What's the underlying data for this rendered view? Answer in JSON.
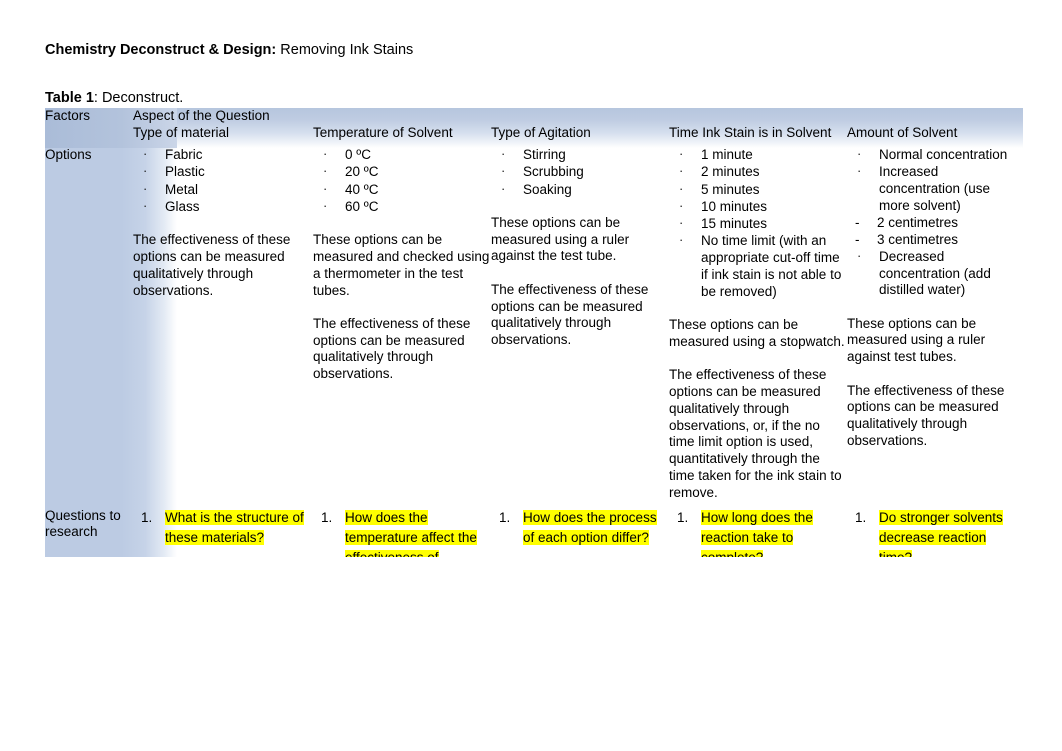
{
  "document": {
    "title_bold": "Chemistry Deconstruct & Design:",
    "title_rest": " Removing Ink Stains",
    "caption_bold": "Table 1",
    "caption_rest": ": Deconstruct."
  },
  "colors": {
    "header_band": "#b6c6de",
    "first_column_band": "#bccbe3",
    "highlight": "#ffff00"
  },
  "table": {
    "header": {
      "factors_label": "Factors",
      "aspect_label": "Aspect of the Question",
      "columns": [
        "Type of material",
        "Temperature of Solvent",
        "Type of Agitation",
        "Time Ink Stain is in Solvent",
        "Amount of Solvent"
      ]
    },
    "rows": [
      {
        "label": "Options",
        "cells": [
          {
            "bullets": [
              "Fabric",
              "Plastic",
              "Metal",
              "Glass"
            ],
            "paragraphs": [
              "The effectiveness of these options can be measured qualitatively through observations."
            ]
          },
          {
            "bullets": [
              "0 ºC",
              "20 ºC",
              "40 ºC",
              "60 ºC"
            ],
            "paragraphs": [
              "These options can be measured and checked using a thermometer in the test tubes.",
              "The effectiveness of these options can be measured qualitatively through observations."
            ]
          },
          {
            "bullets": [
              "Stirring",
              "Scrubbing",
              "Soaking"
            ],
            "paragraphs": [
              "These options can be measured using a ruler against the test tube.",
              "The effectiveness of these options can be measured qualitatively through observations."
            ]
          },
          {
            "bullets": [
              "1 minute",
              "2 minutes",
              "5 minutes",
              "10 minutes",
              "15 minutes",
              "No time limit (with an appropriate cut-off time if ink stain is not able to be removed)"
            ],
            "paragraphs": [
              "These options can be measured using a stopwatch.",
              "The effectiveness of these options can be measured qualitatively through observations, or, if the no time limit option is used, quantitatively through the time taken for the ink stain to remove."
            ]
          },
          {
            "bullets": [
              "Normal concentration",
              "Increased concentration (use more solvent)",
              "Decreased concentration (add distilled water)"
            ],
            "sub_bullets_after": 1,
            "sub_bullets": [
              "2 centimetres",
              "3 centimetres"
            ],
            "paragraphs": [
              "These options can be measured using a ruler against test tubes.",
              "The effectiveness of these options can be measured qualitatively through observations."
            ]
          }
        ]
      },
      {
        "label": "Questions to research",
        "questions": [
          {
            "number": "1.",
            "text": "What is the structure of these materials?"
          },
          {
            "number": "1.",
            "text": "How does the temperature affect the effectiveness of"
          },
          {
            "number": "1.",
            "text": "How does the process of each option differ?"
          },
          {
            "number": "1.",
            "text": "How long does the reaction take to complete?"
          },
          {
            "number": "1.",
            "text": "Do stronger solvents decrease reaction time?"
          }
        ]
      }
    ]
  }
}
